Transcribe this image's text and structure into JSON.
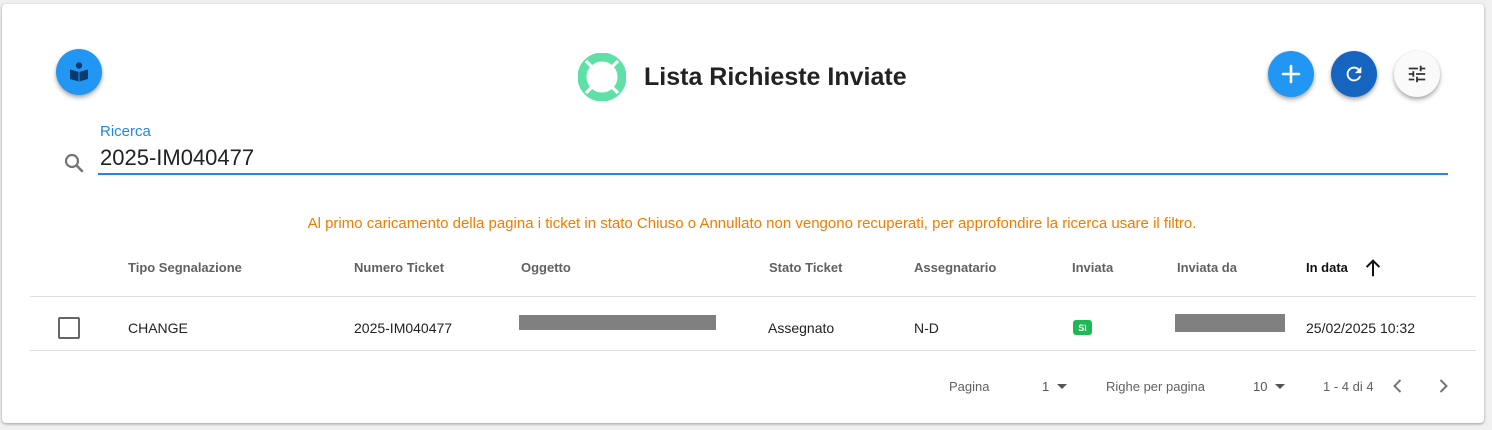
{
  "header": {
    "title": "Lista Richieste Inviate",
    "title_icon": "lifebuoy-icon",
    "left_button": {
      "icon": "book-reader-icon",
      "color": "#2196f3"
    },
    "actions": [
      {
        "name": "add",
        "icon": "plus-icon",
        "color": "#2196f3"
      },
      {
        "name": "refresh",
        "icon": "refresh-icon",
        "color": "#1565c0"
      },
      {
        "name": "filter",
        "icon": "tune-icon",
        "color": "#fafafa"
      }
    ]
  },
  "search": {
    "label": "Ricerca",
    "value": "2025-IM040477",
    "icon": "search-icon"
  },
  "notice": "Al primo caricamento della pagina i ticket in stato Chiuso o Annullato non vengono recuperati, per approfondire la ricerca usare il filtro.",
  "table": {
    "columns": [
      "Tipo Segnalazione",
      "Numero Ticket",
      "Oggetto",
      "Stato Ticket",
      "Assegnatario",
      "Inviata",
      "Inviata da",
      "In data"
    ],
    "sorted_column": "In data",
    "sort_direction": "ascending",
    "rows": [
      {
        "tipo": "CHANGE",
        "numero": "2025-IM040477",
        "stato": "Assegnato",
        "assegnatario": "N-D",
        "inviata": "Sì",
        "in_data": "25/02/2025 10:32"
      }
    ]
  },
  "pagination": {
    "page_label": "Pagina",
    "page_value": "1",
    "rows_label": "Righe per pagina",
    "rows_value": "10",
    "range": "1 - 4 di 4"
  },
  "colors": {
    "accent": "#1e88e5",
    "warning": "#ef7c00",
    "title_icon": "#5fe0a6",
    "badge": "#1db954"
  }
}
